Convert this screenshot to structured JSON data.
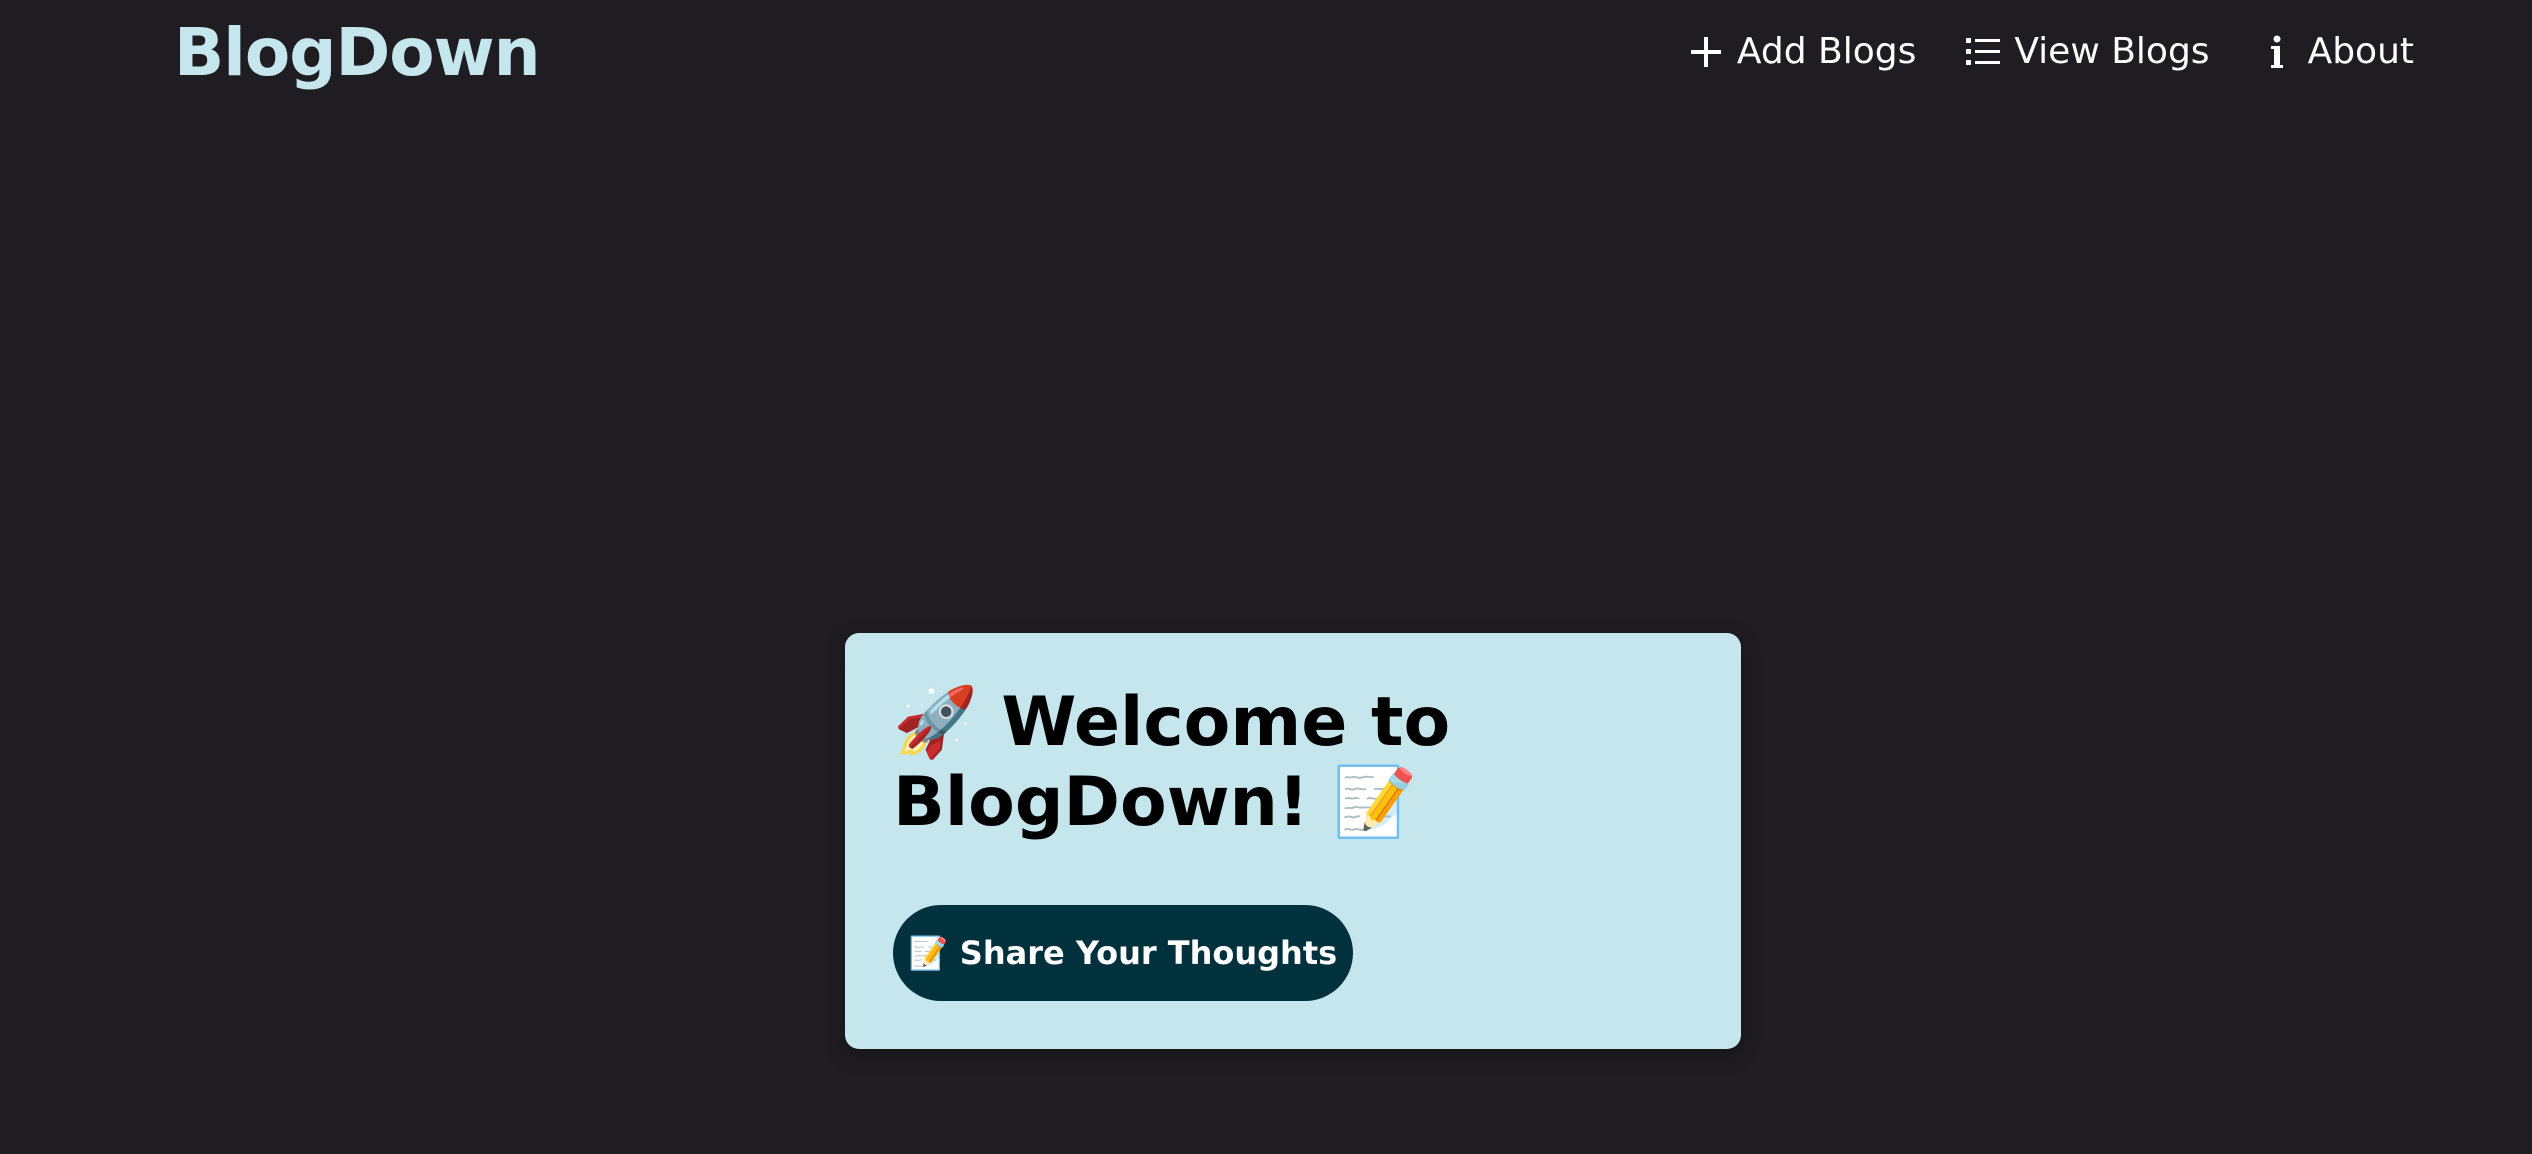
{
  "brand": {
    "name": "BlogDown"
  },
  "nav": {
    "items": [
      {
        "label": "Add Blogs",
        "icon": "plus-icon"
      },
      {
        "label": "View Blogs",
        "icon": "list-icon"
      },
      {
        "label": "About",
        "icon": "info-icon"
      }
    ]
  },
  "hero": {
    "title": "🚀 Welcome to BlogDown! 📝",
    "cta_label": "📝 Share Your Thoughts"
  },
  "colors": {
    "background": "#1f1d21",
    "brand": "#c5e6ec",
    "card": "#c5e6ec",
    "button": "#01313c"
  }
}
